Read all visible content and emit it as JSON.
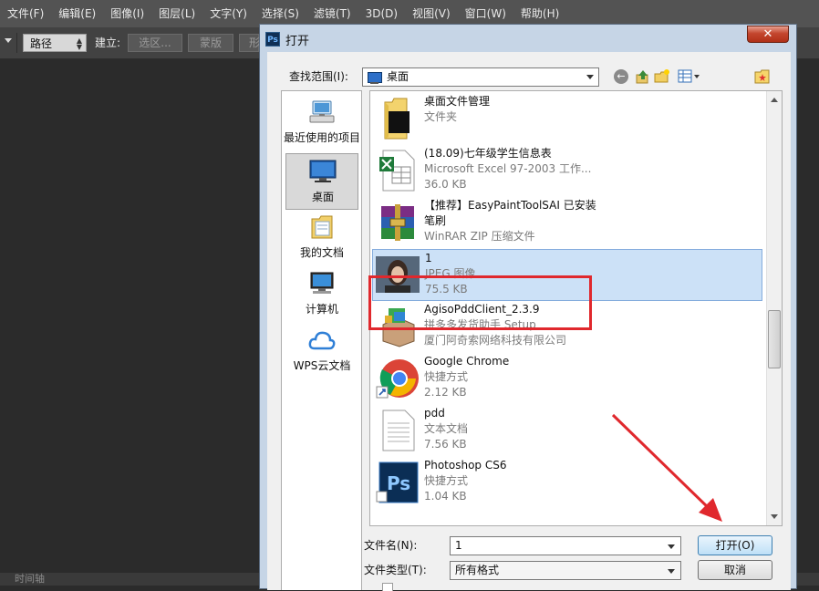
{
  "ps_menubar": {
    "items": [
      "文件(F)",
      "编辑(E)",
      "图像(I)",
      "图层(L)",
      "文字(Y)",
      "选择(S)",
      "滤镜(T)",
      "3D(D)",
      "视图(V)",
      "窗口(W)",
      "帮助(H)"
    ]
  },
  "ps_options": {
    "path_select": "路径",
    "build_label": "建立:",
    "selection_button": "选区...",
    "mask_button": "蒙版",
    "shape_button_partial": "形"
  },
  "ps_status": {
    "timeline_label": "时间轴"
  },
  "dialog": {
    "title": "打开",
    "close_symbol": "✕",
    "look_in_label": "查找范围(I):",
    "look_in_value": "桌面",
    "places": [
      {
        "label": "最近使用的项目",
        "icon": "recent-items-icon"
      },
      {
        "label": "桌面",
        "icon": "desktop-icon",
        "selected": true
      },
      {
        "label": "我的文档",
        "icon": "my-documents-icon"
      },
      {
        "label": "计算机",
        "icon": "computer-icon"
      },
      {
        "label": "WPS云文档",
        "icon": "wps-cloud-icon"
      }
    ],
    "files": [
      {
        "name": "桌面文件管理",
        "line1": "文件夹",
        "line2": "",
        "icon": "folder-icon"
      },
      {
        "name": "(18.09)七年级学生信息表",
        "line1": "Microsoft Excel 97-2003 工作...",
        "line2": "36.0 KB",
        "icon": "excel-icon"
      },
      {
        "name": "【推荐】EasyPaintToolSAI 已安装笔刷",
        "line1": "WinRAR ZIP 压缩文件",
        "line2": "",
        "icon": "winrar-icon"
      },
      {
        "name": "1",
        "line1": "JPEG 图像",
        "line2": "75.5 KB",
        "icon": "jpeg-thumbnail-icon",
        "selected": true
      },
      {
        "name": "AgisoPddClient_2.3.9",
        "line1": "拼多多发货助手 Setup",
        "line2": "厦门阿奇索网络科技有限公司",
        "icon": "installer-icon"
      },
      {
        "name": "Google Chrome",
        "line1": "快捷方式",
        "line2": "2.12 KB",
        "icon": "chrome-icon"
      },
      {
        "name": "pdd",
        "line1": "文本文档",
        "line2": "7.56 KB",
        "icon": "text-document-icon"
      },
      {
        "name": "Photoshop CS6",
        "line1": "快捷方式",
        "line2": "1.04 KB",
        "icon": "photoshop-icon"
      }
    ],
    "file_name_label": "文件名(N):",
    "file_name_value": "1",
    "file_type_label": "文件类型(T):",
    "file_type_value": "所有格式",
    "open_button": "打开(O)",
    "cancel_button": "取消"
  },
  "colors": {
    "ps_menubar_bg": "#535353",
    "ps_workspace_bg": "#2b2b2b",
    "dialog_frame": "#c6d5e6",
    "selection_bg": "#cce1f7",
    "highlight_red": "#e0282d"
  }
}
